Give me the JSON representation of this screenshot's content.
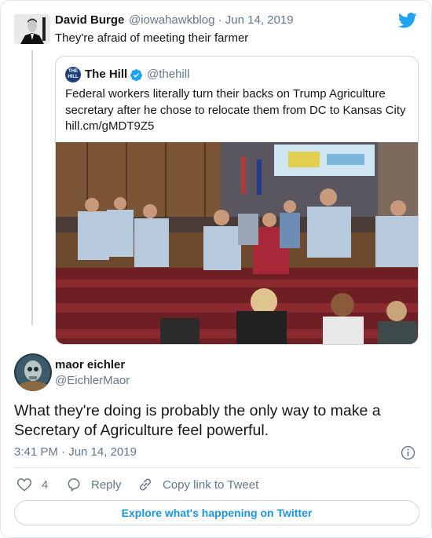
{
  "parent": {
    "name": "David Burge",
    "handle": "@iowahawkblog",
    "date": "Jun 14, 2019",
    "text": "They're afraid of meeting their farmer",
    "avatar_icon": "man-in-suit-avatar"
  },
  "quote": {
    "name": "The Hill",
    "handle": "@thehill",
    "logo_text": "THE HILL",
    "verified_icon": "verified-badge-icon",
    "text_line1": "Federal workers literally turn their backs on Trump Agriculture",
    "text_line2": "secretary after he chose to relocate them from DC to Kansas City",
    "link": "hill.cm/gMDT9Z5",
    "photo_icon": "auditorium-photo"
  },
  "reply": {
    "name": "maor eichler",
    "handle": "@EichlerMaor",
    "text_line1": "What they're doing is probably the only way to make a",
    "text_line2": "Secretary of Agriculture feel powerful.",
    "time": "3:41 PM · Jun 14, 2019"
  },
  "actions": {
    "like_count": "4",
    "reply_label": "Reply",
    "copy_label": "Copy link to Tweet"
  },
  "explore_label": "Explore what's happening on Twitter",
  "colors": {
    "twitter_blue": "#1da1f2",
    "link_blue": "#1b95e0",
    "muted_text": "#657786",
    "border": "#e1e8ed"
  }
}
